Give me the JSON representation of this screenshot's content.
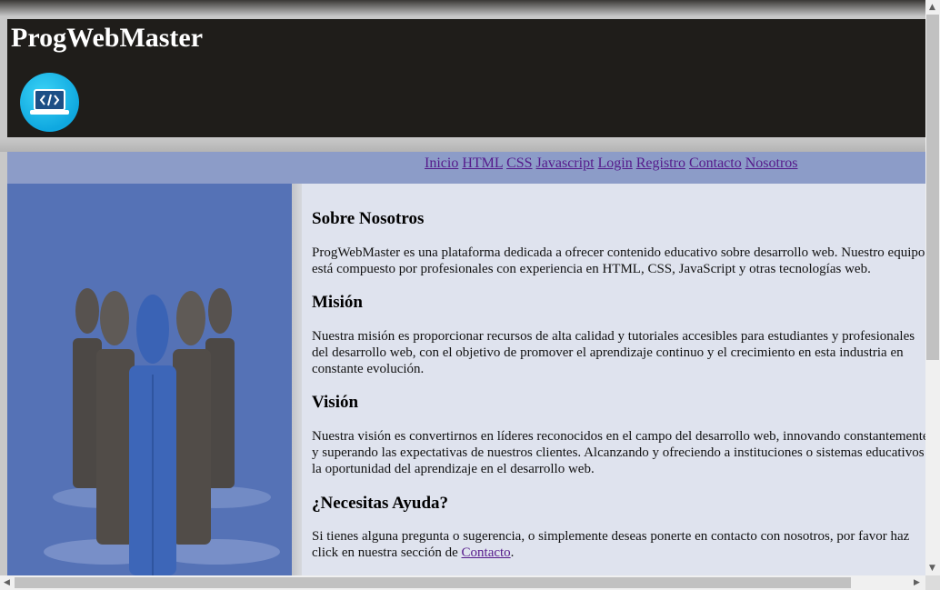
{
  "header": {
    "title": "ProgWebMaster",
    "logo_icon": "laptop-code-icon"
  },
  "nav": {
    "items": [
      "Inicio",
      "HTML",
      "CSS",
      "Javascript",
      "Login",
      "Registro",
      "Contacto",
      "Nosotros"
    ]
  },
  "side": {
    "image_icon": "team-people-icon"
  },
  "content": {
    "about_title": "Sobre Nosotros",
    "about_text": "ProgWebMaster es una plataforma dedicada a ofrecer contenido educativo sobre desarrollo web. Nuestro equipo está compuesto por profesionales con experiencia en HTML, CSS, JavaScript y otras tecnologías web.",
    "mission_title": "Misión",
    "mission_text": "Nuestra misión es proporcionar recursos de alta calidad y tutoriales accesibles para estudiantes y profesionales del desarrollo web, con el objetivo de promover el aprendizaje continuo y el crecimiento en esta industria en constante evolución.",
    "vision_title": "Visión",
    "vision_text": "Nuestra visión es convertirnos en líderes reconocidos en el campo del desarrollo web, innovando constantemente y superando las expectativas de nuestros clientes. Alcanzando y ofreciendo a instituciones o sistemas educativos la oportunidad del aprendizaje en el desarrollo web.",
    "help_title": "¿Necesitas Ayuda?",
    "help_text_before": "Si tienes alguna pregunta o sugerencia, o simplemente deseas ponerte en contacto con nosotros, por favor haz click en nuestra sección de ",
    "help_link": "Contacto",
    "help_text_after": "."
  },
  "colors": {
    "header_bg": "#1f1d1a",
    "nav_bg": "#8c9cc8",
    "side_bg": "#5572b6",
    "content_bg": "#dfe3ee",
    "link": "#551a8b"
  }
}
